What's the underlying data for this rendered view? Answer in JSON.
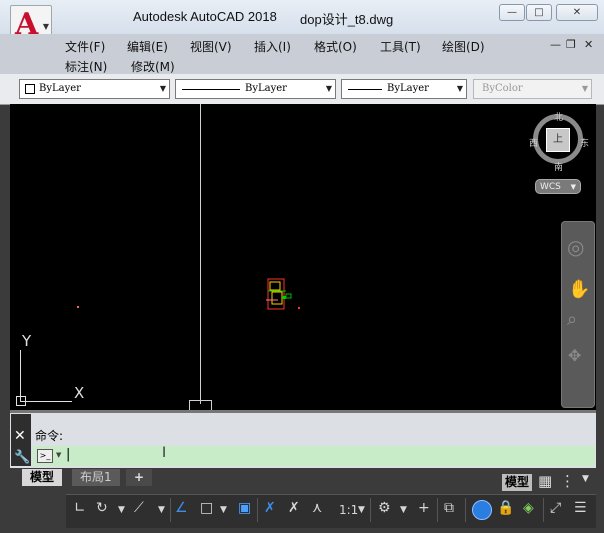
{
  "window": {
    "app_title": "Autodesk AutoCAD 2018",
    "doc_title": "dop设计_t8.dwg",
    "minimize": "—",
    "maximize": "□",
    "close": "✕",
    "app_letter": "A"
  },
  "menu": {
    "row1": [
      "文件(F)",
      "编辑(E)",
      "视图(V)",
      "插入(I)",
      "格式(O)",
      "工具(T)",
      "绘图(D)"
    ],
    "row2": [
      "标注(N)",
      "修改(M)"
    ]
  },
  "properties": {
    "layer": "ByLayer",
    "linetype": "ByLayer",
    "lineweight": "ByLayer",
    "color": "ByColor"
  },
  "viewcube": {
    "north": "北",
    "south": "南",
    "east": "东",
    "west": "西",
    "face": "上",
    "wcs": "WCS"
  },
  "ucs": {
    "x": "X",
    "y": "Y"
  },
  "command": {
    "history": "命令:",
    "input_value": "|"
  },
  "layout_tabs": [
    "模型",
    "布局1",
    "+"
  ],
  "status": {
    "model_label": "模型",
    "scale": "1:1"
  },
  "colors": {
    "canvas": "#000000",
    "command_input_bg": "#c9ecc8",
    "app_logo": "#c8102e",
    "status_bg": "#2f2f2f"
  }
}
